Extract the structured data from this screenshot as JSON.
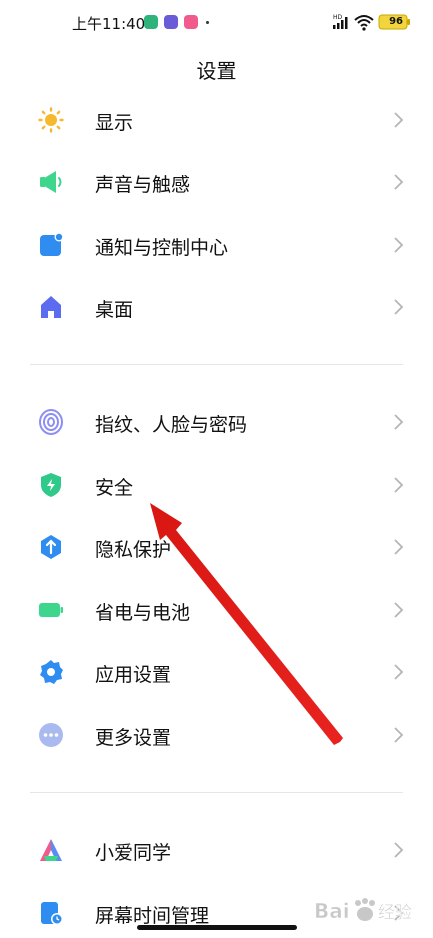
{
  "status_bar": {
    "time": "上午11:40",
    "battery": "96"
  },
  "header": {
    "title": "设置"
  },
  "settings": [
    {
      "label": "显示",
      "icon": "sun-icon",
      "color": "#F5B82E"
    },
    {
      "label": "声音与触感",
      "icon": "speaker-icon",
      "color": "#3DD68C"
    },
    {
      "label": "通知与控制中心",
      "icon": "notification-icon",
      "color": "#2F8CF0"
    },
    {
      "label": "桌面",
      "icon": "home-icon",
      "color": "#5B6CF0"
    },
    {
      "label": "指纹、人脸与密码",
      "icon": "fingerprint-icon",
      "color": "#7B7CF2"
    },
    {
      "label": "安全",
      "icon": "shield-icon",
      "color": "#2FC98A"
    },
    {
      "label": "隐私保护",
      "icon": "privacy-icon",
      "color": "#2F8CF0"
    },
    {
      "label": "省电与电池",
      "icon": "battery-icon",
      "color": "#3DD68C"
    },
    {
      "label": "应用设置",
      "icon": "gear-icon",
      "color": "#2F8CF0"
    },
    {
      "label": "更多设置",
      "icon": "more-icon",
      "color": "#8FA5E8"
    },
    {
      "label": "小爱同学",
      "icon": "xiaoai-icon",
      "color": "#5B8CF0"
    },
    {
      "label": "屏幕时间管理",
      "icon": "screen-time-icon",
      "color": "#2F8CF0"
    }
  ],
  "watermark": {
    "brand": "Bai",
    "suffix": "经验"
  },
  "colors": {
    "annotation_arrow": "#E8231F",
    "chevron": "#B5B5B5"
  }
}
